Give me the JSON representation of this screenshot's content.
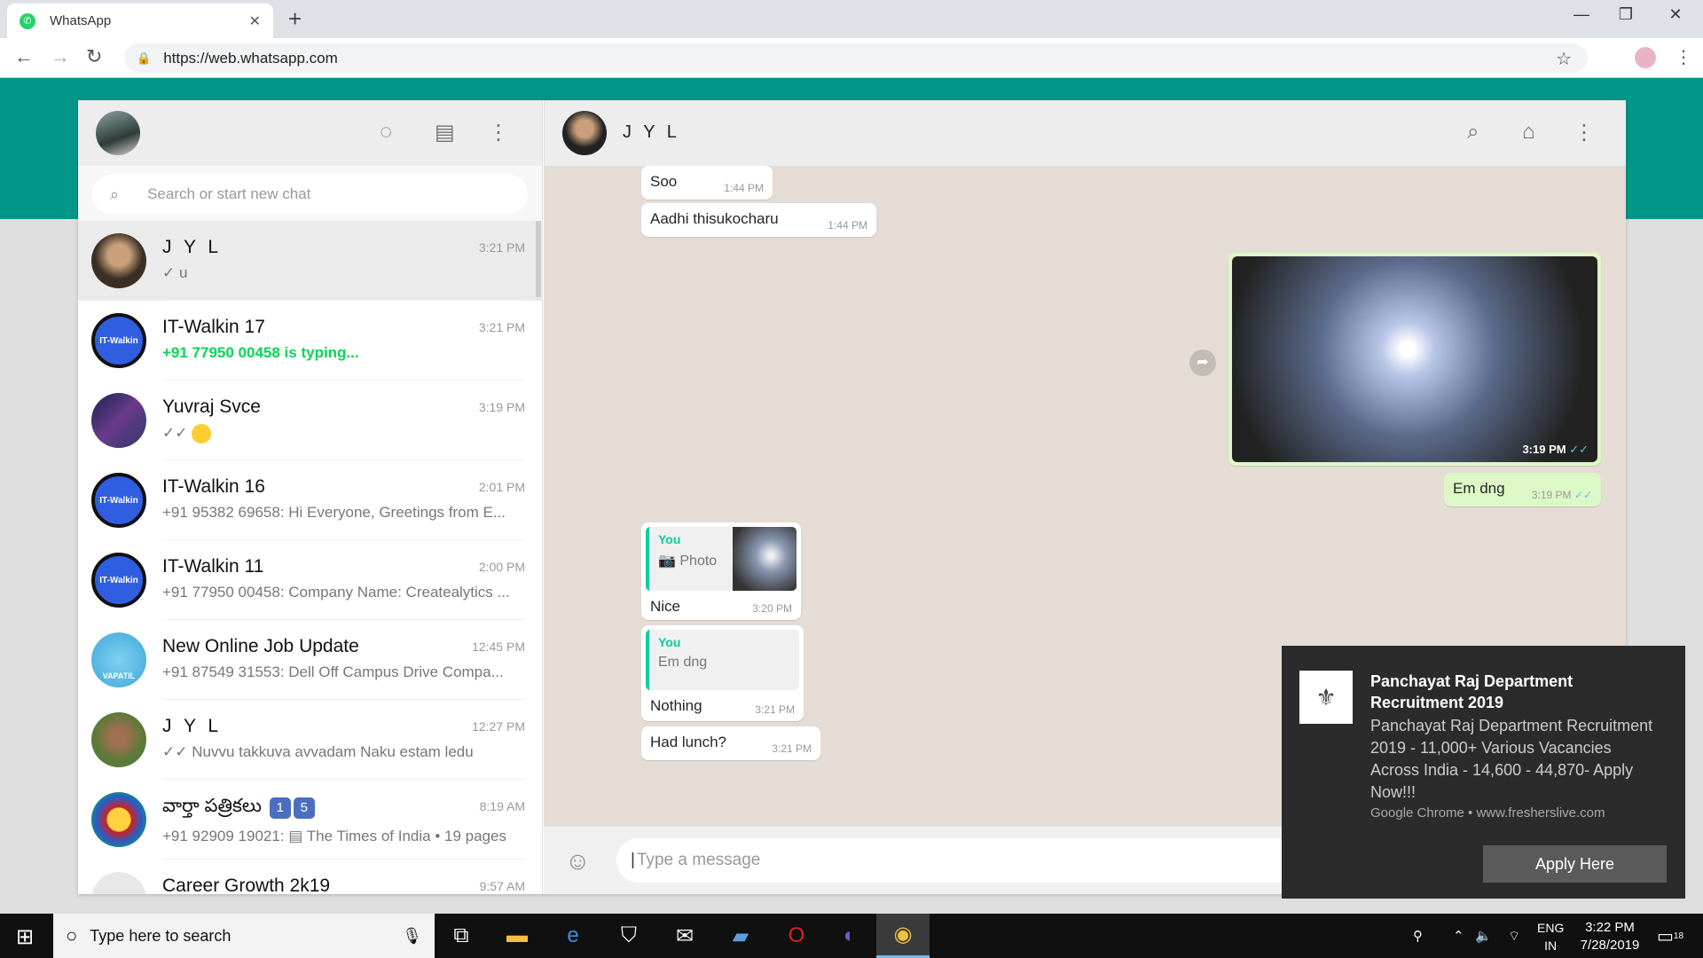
{
  "browser": {
    "tab_title": "WhatsApp",
    "url": "https://web.whatsapp.com"
  },
  "search": {
    "placeholder": "Search or start new chat"
  },
  "chats": [
    {
      "name": "J Y L",
      "time": "3:21 PM",
      "preview": "✓ u",
      "avatar_color": "#5a4a3a"
    },
    {
      "name": "IT-Walkin 17",
      "time": "3:21 PM",
      "preview": "+91 77950 00458 is typing...",
      "avatar_text": "IT-Walkin",
      "avatar_color": "#2f5fe0"
    },
    {
      "name": "Yuvraj Svce",
      "time": "3:19 PM",
      "preview": "✓✓",
      "avatar_color": "#2c3a6a"
    },
    {
      "name": "IT-Walkin 16",
      "time": "2:01 PM",
      "preview": "+91 95382 69658: Hi Everyone, Greetings from E...",
      "avatar_text": "IT-Walkin",
      "avatar_color": "#2f5fe0"
    },
    {
      "name": "IT-Walkin 11",
      "time": "2:00 PM",
      "preview": "+91 77950 00458: Company Name: Createalytics ...",
      "avatar_text": "IT-Walkin",
      "avatar_color": "#2f5fe0"
    },
    {
      "name": "New Online Job Update",
      "time": "12:45 PM",
      "preview": "+91 87549 31553: Dell Off Campus Drive Compa...",
      "avatar_text": "VAPATIL",
      "avatar_color": "#3fa8d8"
    },
    {
      "name": "J Y L",
      "time": "12:27 PM",
      "preview": "✓✓ Nuvvu takkuva avvadam Naku estam ledu",
      "avatar_color": "#8a5a3a"
    },
    {
      "name": "వార్తా పత్రికలు",
      "time": "8:19 AM",
      "preview": "+91 92909 19021: ▤ The Times of India • 19 pages",
      "avatar_color": "#d02020",
      "badges": [
        "1",
        "5"
      ]
    },
    {
      "name": "Career Growth 2k19",
      "time": "9:57 AM",
      "preview": "",
      "avatar_color": "#e0e0e0"
    }
  ],
  "conversation": {
    "contact_name": "J Y L",
    "messages": [
      {
        "text": "Soo",
        "time": "1:44 PM"
      },
      {
        "text": "Aadhi thisukocharu",
        "time": "1:44 PM"
      },
      {
        "photo_time": "3:19 PM"
      },
      {
        "text": "Em dng",
        "time": "3:19 PM"
      },
      {
        "quote_author": "You",
        "quote_text": "Photo",
        "text": "Nice",
        "time": "3:20 PM"
      },
      {
        "quote_author": "You",
        "quote_text": "Em dng",
        "text": "Nothing",
        "time": "3:21 PM"
      },
      {
        "text": "Had lunch?",
        "time": "3:21 PM"
      }
    ],
    "composer_placeholder": "Type a message"
  },
  "notification": {
    "title": "Panchayat Raj Department Recruitment 2019",
    "body": "Panchayat Raj Department Recruitment 2019 - 11,000+ Various Vacancies  Across India - 14,600 - 44,870- Apply Now!!!",
    "source": "Google Chrome • www.fresherslive.com",
    "button": "Apply Here"
  },
  "taskbar": {
    "search_placeholder": "Type here to search",
    "lang_line1": "ENG",
    "lang_line2": "IN",
    "time": "3:22 PM",
    "date": "7/28/2019",
    "notif_count": "18"
  },
  "colors": {
    "teal": "#009688",
    "bubble_out": "#dcf8c6",
    "typing": "#06d755"
  }
}
